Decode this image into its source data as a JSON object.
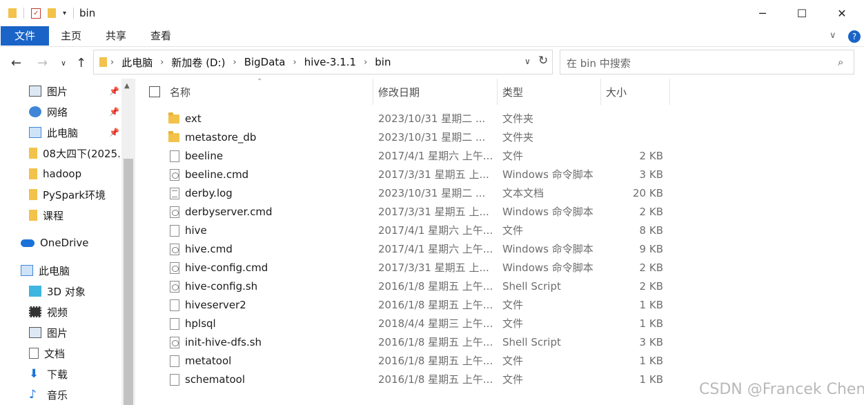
{
  "window": {
    "title": "bin",
    "minimize": "─",
    "maximize": "☐",
    "close": "✕"
  },
  "ribbon": {
    "tabs": [
      "文件",
      "主页",
      "共享",
      "查看"
    ],
    "expand_glyph": "∨",
    "help_glyph": "?"
  },
  "address": {
    "crumbs": [
      "此电脑",
      "新加卷 (D:)",
      "BigData",
      "hive-3.1.1",
      "bin"
    ],
    "search_placeholder": "在 bin 中搜索"
  },
  "sidebar": {
    "items": [
      {
        "label": "图片",
        "icon": "pictures-icon",
        "pinned": true
      },
      {
        "label": "网络",
        "icon": "network-icon",
        "pinned": true
      },
      {
        "label": "此电脑",
        "icon": "this-pc-icon",
        "pinned": true
      },
      {
        "label": "08大四下(2025.",
        "icon": "folder-icon",
        "pinned": false
      },
      {
        "label": "hadoop",
        "icon": "folder-icon",
        "pinned": false
      },
      {
        "label": "PySpark环境",
        "icon": "folder-icon",
        "pinned": false
      },
      {
        "label": "课程",
        "icon": "folder-icon",
        "pinned": false
      },
      {
        "label": "OneDrive",
        "icon": "onedrive-icon",
        "pinned": false
      },
      {
        "label": "此电脑",
        "icon": "this-pc-icon",
        "pinned": false
      },
      {
        "label": "3D 对象",
        "icon": "3d-objects-icon",
        "pinned": false
      },
      {
        "label": "视频",
        "icon": "videos-icon",
        "pinned": false
      },
      {
        "label": "图片",
        "icon": "pictures-icon",
        "pinned": false
      },
      {
        "label": "文档",
        "icon": "documents-icon",
        "pinned": false
      },
      {
        "label": "下载",
        "icon": "downloads-icon",
        "pinned": false
      },
      {
        "label": "音乐",
        "icon": "music-icon",
        "pinned": false
      }
    ]
  },
  "columns": {
    "name": "名称",
    "date": "修改日期",
    "type": "类型",
    "size": "大小"
  },
  "files": [
    {
      "name": "ext",
      "date": "2023/10/31 星期二 ...",
      "type": "文件夹",
      "size": "",
      "kind": "folder"
    },
    {
      "name": "metastore_db",
      "date": "2023/10/31 星期二 ...",
      "type": "文件夹",
      "size": "",
      "kind": "folder"
    },
    {
      "name": "beeline",
      "date": "2017/4/1 星期六 上午...",
      "type": "文件",
      "size": "2 KB",
      "kind": "file"
    },
    {
      "name": "beeline.cmd",
      "date": "2017/3/31 星期五 上...",
      "type": "Windows 命令脚本",
      "size": "3 KB",
      "kind": "cmd"
    },
    {
      "name": "derby.log",
      "date": "2023/10/31 星期二 ...",
      "type": "文本文档",
      "size": "20 KB",
      "kind": "text"
    },
    {
      "name": "derbyserver.cmd",
      "date": "2017/3/31 星期五 上...",
      "type": "Windows 命令脚本",
      "size": "2 KB",
      "kind": "cmd"
    },
    {
      "name": "hive",
      "date": "2017/4/1 星期六 上午...",
      "type": "文件",
      "size": "8 KB",
      "kind": "file"
    },
    {
      "name": "hive.cmd",
      "date": "2017/4/1 星期六 上午...",
      "type": "Windows 命令脚本",
      "size": "9 KB",
      "kind": "cmd"
    },
    {
      "name": "hive-config.cmd",
      "date": "2017/3/31 星期五 上...",
      "type": "Windows 命令脚本",
      "size": "2 KB",
      "kind": "cmd"
    },
    {
      "name": "hive-config.sh",
      "date": "2016/1/8 星期五 上午...",
      "type": "Shell Script",
      "size": "2 KB",
      "kind": "cmd"
    },
    {
      "name": "hiveserver2",
      "date": "2016/1/8 星期五 上午...",
      "type": "文件",
      "size": "1 KB",
      "kind": "file"
    },
    {
      "name": "hplsql",
      "date": "2018/4/4 星期三 上午...",
      "type": "文件",
      "size": "1 KB",
      "kind": "file"
    },
    {
      "name": "init-hive-dfs.sh",
      "date": "2016/1/8 星期五 上午...",
      "type": "Shell Script",
      "size": "3 KB",
      "kind": "cmd"
    },
    {
      "name": "metatool",
      "date": "2016/1/8 星期五 上午...",
      "type": "文件",
      "size": "1 KB",
      "kind": "file"
    },
    {
      "name": "schematool",
      "date": "2016/1/8 星期五 上午...",
      "type": "文件",
      "size": "1 KB",
      "kind": "file"
    }
  ],
  "watermark": "CSDN @Francek Chen",
  "colors": {
    "accent": "#1a64c8",
    "folder": "#f2c24b"
  }
}
